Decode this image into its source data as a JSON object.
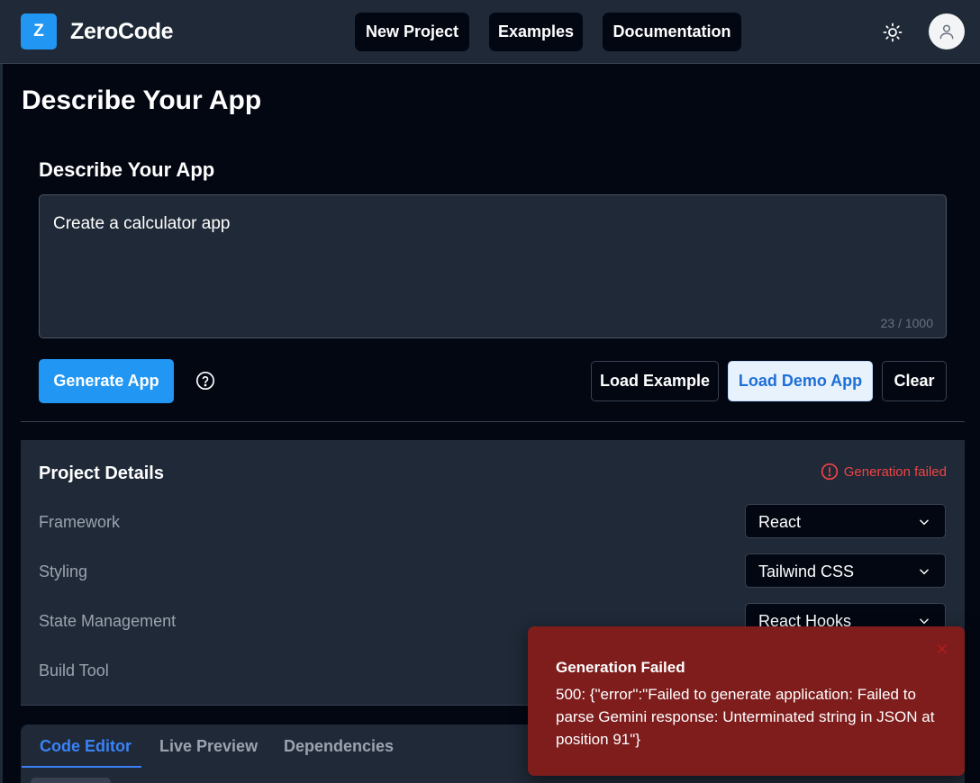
{
  "header": {
    "logo_letter": "Z",
    "app_name": "ZeroCode",
    "nav": [
      {
        "label": "New Project"
      },
      {
        "label": "Examples"
      },
      {
        "label": "Documentation"
      }
    ],
    "theme_icon": "sun-icon",
    "avatar_icon": "user-icon"
  },
  "page": {
    "title": "Describe Your App"
  },
  "prompt": {
    "section_title": "Describe Your App",
    "value": "Create a calculator app",
    "char_count": "23 / 1000"
  },
  "actions": {
    "generate_label": "Generate App",
    "help_icon": "question-circle-icon",
    "load_example_label": "Load Example",
    "load_demo_label": "Load Demo App",
    "clear_label": "Clear"
  },
  "project_details": {
    "title": "Project Details",
    "status": "Generation failed",
    "rows": [
      {
        "label": "Framework",
        "value": "React"
      },
      {
        "label": "Styling",
        "value": "Tailwind CSS"
      },
      {
        "label": "State Management",
        "value": "React Hooks"
      },
      {
        "label": "Build Tool",
        "value": ""
      }
    ]
  },
  "tabs": [
    {
      "label": "Code Editor",
      "active": true
    },
    {
      "label": "Live Preview",
      "active": false
    },
    {
      "label": "Dependencies",
      "active": false
    }
  ],
  "toast": {
    "title": "Generation Failed",
    "message": "500: {\"error\":\"Failed to generate application: Failed to parse Gemini response: Unterminated string in JSON at position 91\"}"
  },
  "colors": {
    "accent": "#2196f3",
    "error": "#ef4444",
    "toast_bg": "#7f1d1d",
    "panel_bg": "#1f2937",
    "page_bg": "#030712"
  }
}
